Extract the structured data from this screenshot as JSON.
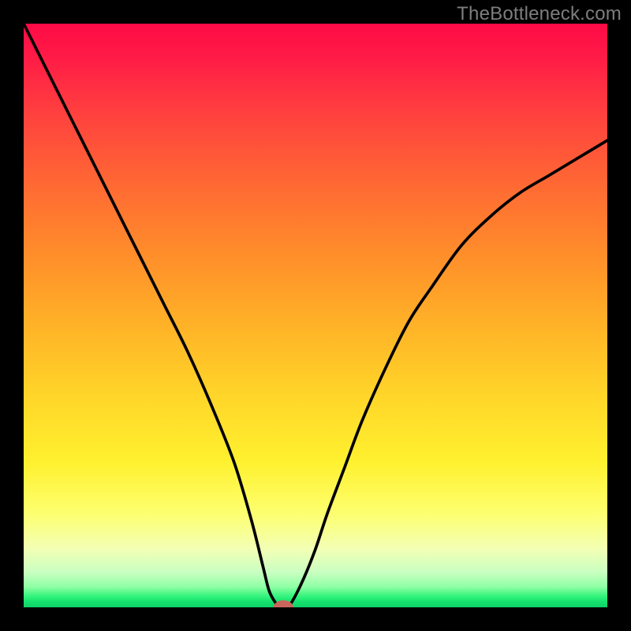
{
  "watermark": "TheBottleneck.com",
  "colors": {
    "frame": "#000000",
    "curve": "#000000",
    "marker_fill": "#c9655c",
    "marker_stroke": "#c9655c",
    "gradient_top": "#ff0a46",
    "gradient_bottom": "#0fd168"
  },
  "chart_data": {
    "type": "line",
    "title": "",
    "xlabel": "",
    "ylabel": "",
    "xlim": [
      0,
      100
    ],
    "ylim": [
      0,
      100
    ],
    "grid": false,
    "legend": false,
    "series": [
      {
        "name": "bottleneck-curve",
        "x": [
          0,
          4,
          8,
          12,
          16,
          20,
          24,
          28,
          32,
          36,
          39,
          41,
          42,
          43,
          44,
          45,
          46,
          48,
          50,
          52,
          55,
          58,
          62,
          66,
          70,
          75,
          80,
          85,
          90,
          95,
          100
        ],
        "y": [
          100,
          92,
          84,
          76,
          68,
          60,
          52,
          44,
          35,
          25,
          15,
          7,
          3,
          1,
          0,
          0,
          1,
          5,
          10,
          16,
          24,
          32,
          41,
          49,
          55,
          62,
          67,
          71,
          74,
          77,
          80
        ]
      }
    ],
    "marker": {
      "x": 44.5,
      "y": 0,
      "rx": 1.6,
      "ry": 1.1
    },
    "annotations": []
  }
}
